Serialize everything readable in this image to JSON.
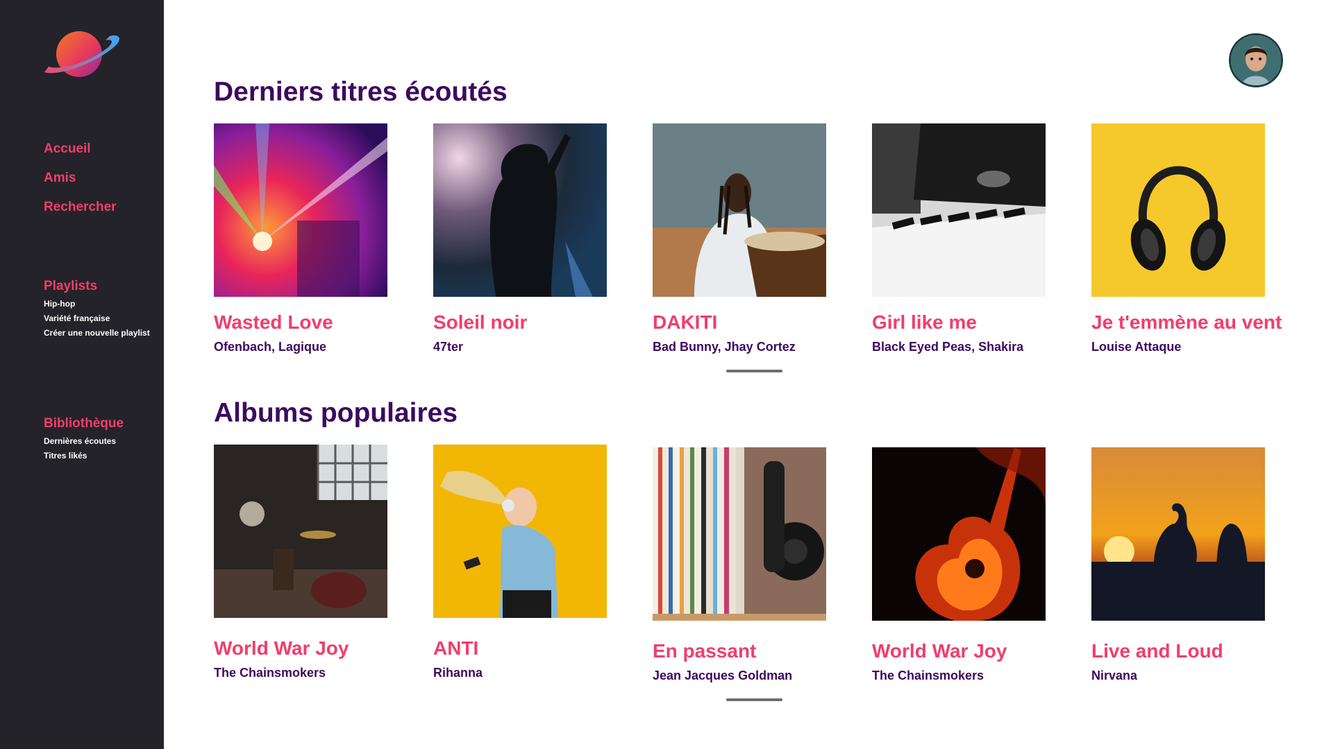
{
  "colors": {
    "sidebar_bg": "#242329",
    "accent": "#f03e6c",
    "heading": "#3d0a5e"
  },
  "logo": {
    "icon": "planet-logo"
  },
  "nav": [
    {
      "label": "Accueil",
      "name": "nav-accueil"
    },
    {
      "label": "Amis",
      "name": "nav-amis"
    },
    {
      "label": "Rechercher",
      "name": "nav-rechercher"
    }
  ],
  "playlists": {
    "title": "Playlists",
    "items": [
      "Hip-hop",
      "Variété française",
      "Créer une nouvelle playlist"
    ]
  },
  "library": {
    "title": "Bibliothèque",
    "items": [
      "Dernières écoutes",
      "Titres likés"
    ]
  },
  "recent": {
    "title": "Derniers titres écoutés",
    "items": [
      {
        "title": "Wasted Love",
        "artist": "Ofenbach, Lagique"
      },
      {
        "title": "Soleil noir",
        "artist": "47ter"
      },
      {
        "title": "DAKITI",
        "artist": "Bad Bunny, Jhay Cortez"
      },
      {
        "title": "Girl like me",
        "artist": "Black Eyed Peas, Shakira"
      },
      {
        "title": "Je t'emmène au vent",
        "artist": "Louise Attaque"
      }
    ]
  },
  "albums": {
    "title": "Albums populaires",
    "items": [
      {
        "title": "World War Joy",
        "artist": "The Chainsmokers"
      },
      {
        "title": "ANTI",
        "artist": "Rihanna"
      },
      {
        "title": "En passant",
        "artist": "Jean Jacques Goldman"
      },
      {
        "title": "World War Joy",
        "artist": "The Chainsmokers"
      },
      {
        "title": "Live and Loud",
        "artist": "Nirvana"
      }
    ]
  }
}
